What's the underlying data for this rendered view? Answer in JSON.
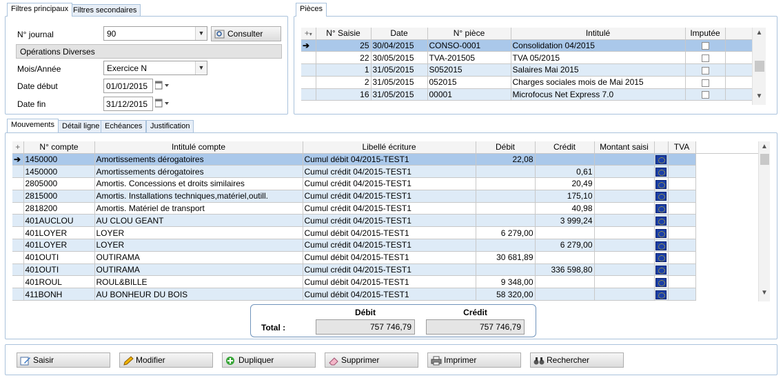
{
  "filters": {
    "tabs": [
      "Filtres principaux",
      "Filtres secondaires"
    ],
    "journal_label": "N° journal",
    "journal_value": "90",
    "consult_label": "Consulter",
    "journal_name": "Opérations Diverses",
    "period_label": "Mois/Année",
    "period_value": "Exercice N",
    "start_label": "Date début",
    "start_value": "01/01/2015",
    "end_label": "Date fin",
    "end_value": "31/12/2015"
  },
  "pieces": {
    "tab": "Pièces",
    "columns": [
      "N° Saisie",
      "Date",
      "N° pièce",
      "Intitulé",
      "Imputée"
    ],
    "rows": [
      {
        "saisie": "25",
        "date": "30/04/2015",
        "piece": "CONSO-0001",
        "intitule": "Consolidation 04/2015"
      },
      {
        "saisie": "22",
        "date": "30/05/2015",
        "piece": "TVA-201505",
        "intitule": "TVA 05/2015"
      },
      {
        "saisie": "1",
        "date": "31/05/2015",
        "piece": "S052015",
        "intitule": "Salaires Mai 2015"
      },
      {
        "saisie": "2",
        "date": "31/05/2015",
        "piece": "052015",
        "intitule": "Charges sociales mois de Mai 2015"
      },
      {
        "saisie": "16",
        "date": "31/05/2015",
        "piece": "00001",
        "intitule": "Microfocus Net Express 7.0"
      }
    ]
  },
  "mouvements": {
    "tabs": [
      "Mouvements",
      "Détail ligne",
      "Echéances",
      "Justification"
    ],
    "columns": [
      "N° compte",
      "Intitulé compte",
      "Libellé écriture",
      "Débit",
      "Crédit",
      "Montant saisi",
      "TVA"
    ],
    "rows": [
      {
        "compte": "1450000",
        "intitule": "Amortissements dérogatoires",
        "libelle": "Cumul débit 04/2015-TEST1",
        "debit": "22,08",
        "credit": ""
      },
      {
        "compte": "1450000",
        "intitule": "Amortissements dérogatoires",
        "libelle": "Cumul crédit 04/2015-TEST1",
        "debit": "",
        "credit": "0,61"
      },
      {
        "compte": "2805000",
        "intitule": "Amortis. Concessions et droits similaires",
        "libelle": "Cumul crédit 04/2015-TEST1",
        "debit": "",
        "credit": "20,49"
      },
      {
        "compte": "2815000",
        "intitule": "Amortis. Installations techniques,matériel,outill.",
        "libelle": "Cumul crédit 04/2015-TEST1",
        "debit": "",
        "credit": "175,10"
      },
      {
        "compte": "2818200",
        "intitule": "Amortis. Matériel de transport",
        "libelle": "Cumul crédit 04/2015-TEST1",
        "debit": "",
        "credit": "40,98"
      },
      {
        "compte": "401AUCLOU",
        "intitule": "AU CLOU GEANT",
        "libelle": "Cumul crédit 04/2015-TEST1",
        "debit": "",
        "credit": "3 999,24"
      },
      {
        "compte": "401LOYER",
        "intitule": "LOYER",
        "libelle": "Cumul débit 04/2015-TEST1",
        "debit": "6 279,00",
        "credit": ""
      },
      {
        "compte": "401LOYER",
        "intitule": "LOYER",
        "libelle": "Cumul crédit 04/2015-TEST1",
        "debit": "",
        "credit": "6 279,00"
      },
      {
        "compte": "401OUTI",
        "intitule": "OUTIRAMA",
        "libelle": "Cumul débit 04/2015-TEST1",
        "debit": "30 681,89",
        "credit": ""
      },
      {
        "compte": "401OUTI",
        "intitule": "OUTIRAMA",
        "libelle": "Cumul crédit 04/2015-TEST1",
        "debit": "",
        "credit": "336 598,80"
      },
      {
        "compte": "401ROUL",
        "intitule": "ROUL&BILLE",
        "libelle": "Cumul débit 04/2015-TEST1",
        "debit": "9 348,00",
        "credit": ""
      },
      {
        "compte": "411BONH",
        "intitule": "AU BONHEUR DU BOIS",
        "libelle": "Cumul débit 04/2015-TEST1",
        "debit": "58 320,00",
        "credit": ""
      }
    ]
  },
  "totals": {
    "debit_label": "Débit",
    "credit_label": "Crédit",
    "total_label": "Total :",
    "debit": "757 746,79",
    "credit": "757 746,79"
  },
  "actions": [
    "Saisir",
    "Modifier",
    "Dupliquer",
    "Supprimer",
    "Imprimer",
    "Rechercher"
  ]
}
